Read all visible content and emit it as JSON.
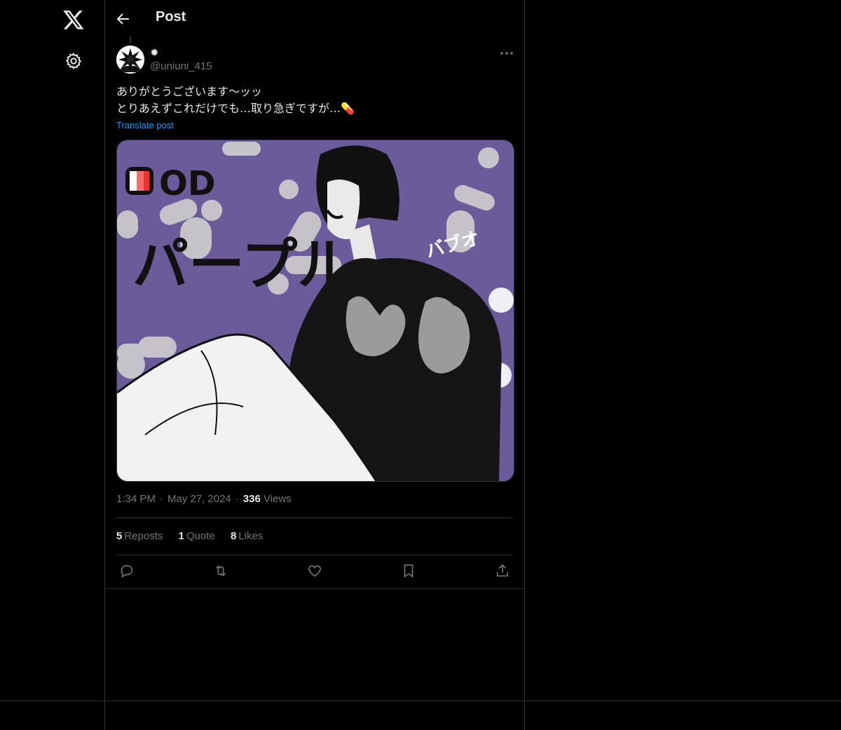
{
  "header": {
    "title": "Post"
  },
  "nav": {
    "logo_icon": "x-logo-icon",
    "settings_icon": "gear-icon"
  },
  "post": {
    "author": {
      "display_name": "✹",
      "handle": "@uniuni_415"
    },
    "text_line1": "ありがとうございます〜ッッ",
    "text_line2": "とりあえずこれだけでも…取り急ぎですが…💊",
    "translate_label": "Translate post",
    "image_texts": {
      "od": "OD",
      "title": "パープル",
      "side": "バブオ"
    },
    "time": "1:34 PM",
    "date": "May 27, 2024",
    "views_count": "336",
    "views_label": "Views",
    "stats": {
      "reposts_count": "5",
      "reposts_label": "Reposts",
      "quotes_count": "1",
      "quotes_label": "Quote",
      "likes_count": "8",
      "likes_label": "Likes"
    }
  },
  "colors": {
    "accent": "#1d9bf0",
    "muted": "#71767b",
    "text": "#e7e9ea",
    "border": "#2f3336",
    "image_bg": "#6b5b9a"
  }
}
